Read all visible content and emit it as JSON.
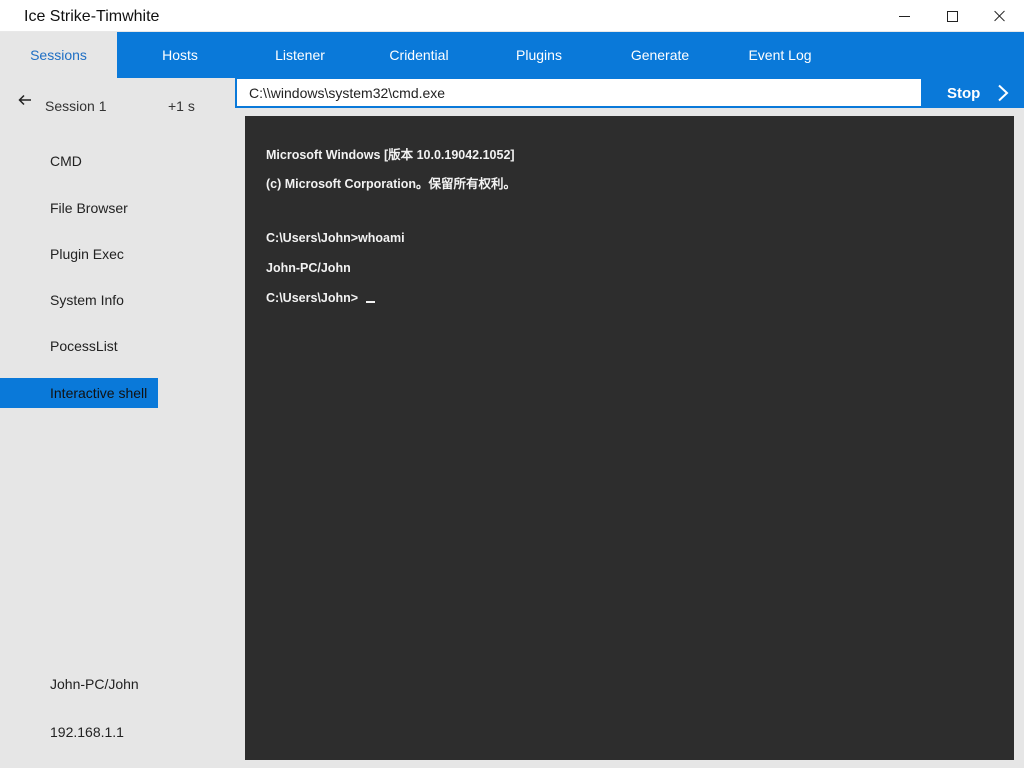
{
  "window": {
    "title": "Ice Strike-Timwhite"
  },
  "nav": {
    "tabs": [
      {
        "label": "Sessions"
      },
      {
        "label": "Hosts"
      },
      {
        "label": "Listener"
      },
      {
        "label": "Cridential"
      },
      {
        "label": "Plugins"
      },
      {
        "label": "Generate"
      },
      {
        "label": "Event Log"
      }
    ],
    "active_tab": "Sessions"
  },
  "sidebar": {
    "session": "Session 1",
    "time": "+1 s",
    "items": [
      {
        "label": "CMD"
      },
      {
        "label": "File Browser"
      },
      {
        "label": "Plugin Exec"
      },
      {
        "label": "System Info"
      },
      {
        "label": "PocessList"
      },
      {
        "label": "Interactive shell"
      }
    ],
    "active_item": "Interactive shell",
    "user": "John-PC/John",
    "ip": "192.168.1.1"
  },
  "shell": {
    "path": "C:\\\\windows\\system32\\cmd.exe",
    "stop_label": "Stop",
    "lines": [
      "Microsoft Windows [版本 10.0.19042.1052]",
      "(c) Microsoft Corporation。保留所有权利。",
      "C:\\Users\\John>whoami",
      "John-PC/John",
      "C:\\Users\\John> "
    ]
  },
  "colors": {
    "accent": "#0a79d9",
    "sidebar_bg": "#e6e6e6",
    "terminal_bg": "#2d2d2d"
  }
}
